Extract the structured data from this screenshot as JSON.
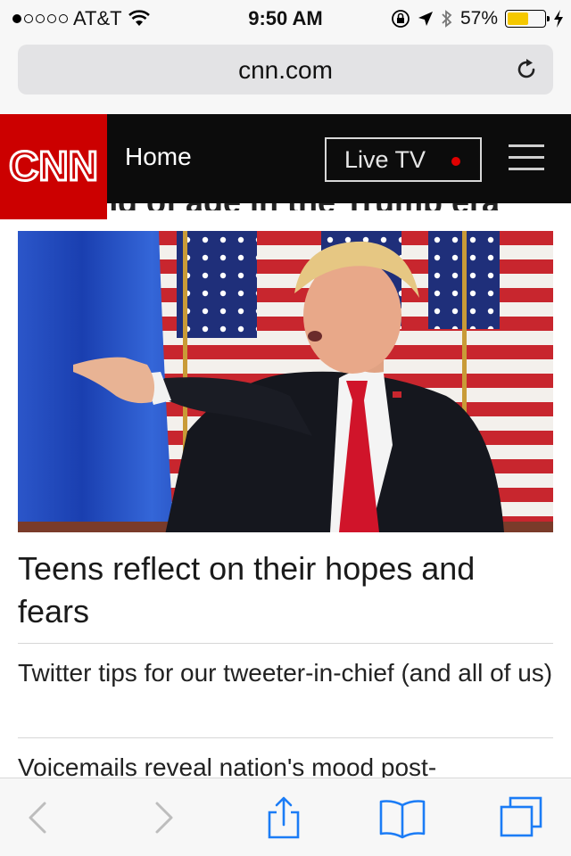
{
  "status_bar": {
    "carrier": "AT&T",
    "time": "9:50 AM",
    "battery": "57%",
    "battery_level": 0.57
  },
  "browser": {
    "url": "cnn.com"
  },
  "cnn_nav": {
    "logo_text": "CNN",
    "home_label": "Home",
    "live_tv_label": "Live TV"
  },
  "content": {
    "partial_headline": "Coming of age in the Trump era",
    "main_headline": "Teens reflect on their hopes and fears",
    "stories": [
      "Twitter tips for our tweeter-in-chief (and all of us)",
      "Voicemails reveal nation's mood post-"
    ]
  },
  "colors": {
    "cnn_red": "#cc0000",
    "header_bg": "#0c0c0c",
    "link_blue": "#1b7cf6",
    "live_dot": "#e00000"
  },
  "icons": [
    "wifi-icon",
    "rotation-lock-icon",
    "location-icon",
    "bluetooth-icon",
    "charging-icon",
    "reload-icon",
    "menu-icon",
    "back-icon",
    "forward-icon",
    "share-icon",
    "bookmarks-icon",
    "tabs-icon"
  ]
}
